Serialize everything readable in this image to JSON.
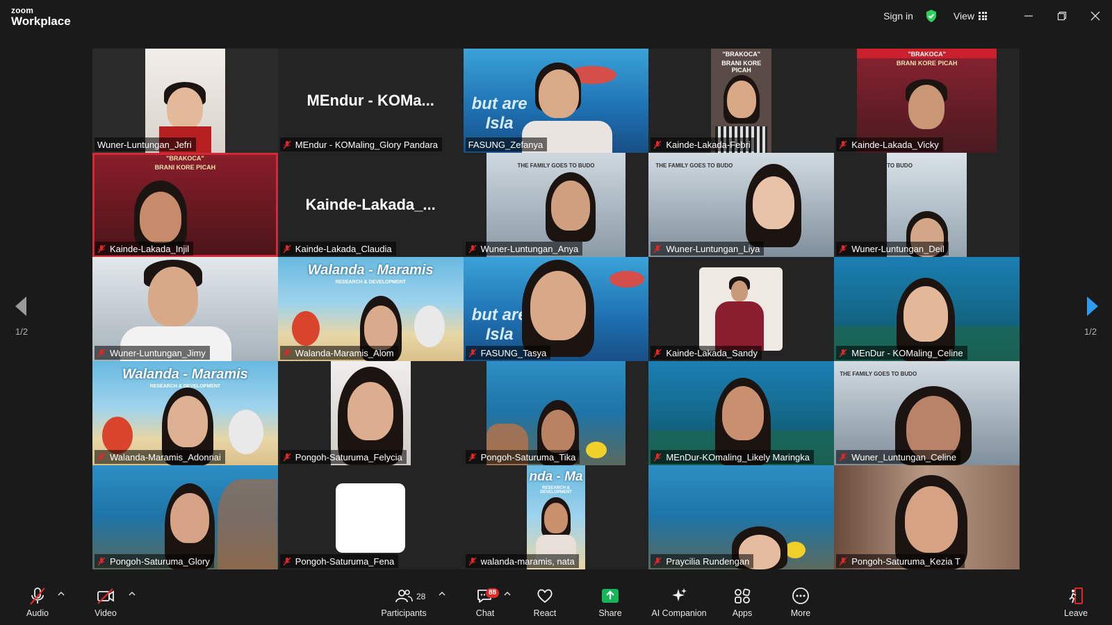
{
  "app": {
    "brand_small": "zoom",
    "brand_big": "Workplace"
  },
  "titlebar": {
    "sign_in": "Sign in",
    "view": "View",
    "shield_color": "#2bd15c"
  },
  "gallery": {
    "page_label_left": "1/2",
    "page_label_right": "1/2",
    "participants": [
      {
        "name": "Wuner-Luntungan_Jefri",
        "muted": false,
        "active_speaker": true,
        "video": true
      },
      {
        "name": "MEndur - KOMaling_Glory Pandara",
        "muted": true,
        "video": false,
        "avatar_text": "MEndur - KOMa..."
      },
      {
        "name": "FASUNG_Zefanya",
        "muted": false,
        "video": true
      },
      {
        "name": "Kainde-Lakada-Febri",
        "muted": true,
        "video": true
      },
      {
        "name": "Kainde-Lakada_Vicky",
        "muted": true,
        "video": true
      },
      {
        "name": "Kainde-Lakada_Injil",
        "muted": true,
        "video": true
      },
      {
        "name": "Kainde-Lakada_Claudia",
        "muted": true,
        "video": false,
        "avatar_text": "Kainde-Lakada_..."
      },
      {
        "name": "Wuner-Luntungan_Anya",
        "muted": true,
        "video": true
      },
      {
        "name": "Wuner-Luntungan_Liya",
        "muted": true,
        "video": true
      },
      {
        "name": "Wuner-Luntungan_Deil",
        "muted": true,
        "video": true
      },
      {
        "name": "Wuner-Luntungan_Jimy",
        "muted": true,
        "video": true
      },
      {
        "name": "Walanda-Maramis_Alom",
        "muted": true,
        "video": true
      },
      {
        "name": "FASUNG_Tasya",
        "muted": true,
        "video": true
      },
      {
        "name": "Kainde-Lakada_Sandy",
        "muted": true,
        "video": true
      },
      {
        "name": "MEnDur - KOMaling_Celine",
        "muted": true,
        "video": true
      },
      {
        "name": "Walanda-Maramis_Adonnai",
        "muted": true,
        "video": true
      },
      {
        "name": "Pongoh-Saturuma_Felycia",
        "muted": true,
        "video": true
      },
      {
        "name": "Pongoh-Saturuma_Tika",
        "muted": true,
        "video": true
      },
      {
        "name": "MEnDur-KOmaling_Likely Maringka",
        "muted": true,
        "video": true
      },
      {
        "name": "Wuner_Luntungan_Celine",
        "muted": true,
        "video": true
      },
      {
        "name": "Pongoh-Saturuma_Glory",
        "muted": true,
        "video": true
      },
      {
        "name": "Pongoh-Saturuma_Fena",
        "muted": true,
        "video": true
      },
      {
        "name": "walanda-maramis, nata",
        "muted": true,
        "video": true
      },
      {
        "name": "Praycilia Rundengan",
        "muted": true,
        "video": true
      },
      {
        "name": "Pongoh-Saturuma_Kezia T",
        "muted": true,
        "video": true
      }
    ],
    "banners": {
      "brakoca_1": "\"BRAKOCA\"",
      "brakoca_2": "BRANI KORE PICAH",
      "walanda": "Walanda - Maramis",
      "walanda_sub": "RESEARCH & DEVELOPMENT",
      "family": "THE FAMILY GOES TO BUDO",
      "family_short": "TO BUDO",
      "walanda_crop": "nda - Ma",
      "sea_words": "but are Isla"
    }
  },
  "toolbar": {
    "audio": "Audio",
    "video": "Video",
    "participants": "Participants",
    "participants_count": "28",
    "chat": "Chat",
    "chat_badge": "88",
    "react": "React",
    "share": "Share",
    "ai_companion": "AI Companion",
    "apps": "Apps",
    "more": "More",
    "leave": "Leave",
    "share_color": "#18b45a",
    "leave_color": "#e02828",
    "muted_color": "#e02828"
  }
}
